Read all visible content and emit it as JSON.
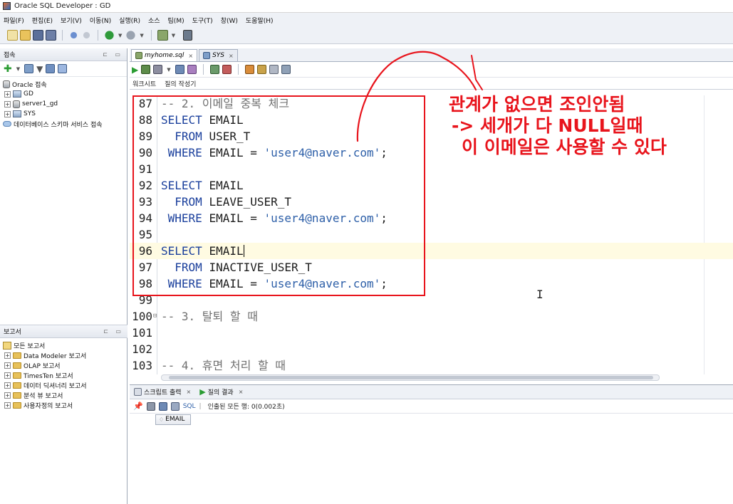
{
  "window": {
    "title": "Oracle SQL Developer : GD"
  },
  "menu": [
    "파일(F)",
    "편집(E)",
    "보기(V)",
    "이동(N)",
    "실행(R)",
    "소스",
    "팀(M)",
    "도구(T)",
    "창(W)",
    "도움말(H)"
  ],
  "connections_panel": {
    "title": "접속",
    "tree": [
      {
        "label": "Oracle 접속",
        "icon": "database-icon"
      },
      {
        "label": "GD",
        "icon": "connection-icon"
      },
      {
        "label": "server1_gd",
        "icon": "database-icon"
      },
      {
        "label": "SYS",
        "icon": "connection-icon"
      },
      {
        "label": "데이터베이스 스키마 서비스 접속",
        "icon": "cloud-icon"
      }
    ]
  },
  "reports_panel": {
    "title": "보고서",
    "tree": [
      {
        "label": "모든 보고서"
      },
      {
        "label": "Data Modeler 보고서"
      },
      {
        "label": "OLAP 보고서"
      },
      {
        "label": "TimesTen 보고서"
      },
      {
        "label": "데이터 딕셔너리 보고서"
      },
      {
        "label": "분석 뷰 보고서"
      },
      {
        "label": "사용자정의 보고서"
      }
    ]
  },
  "editor": {
    "tabs": [
      {
        "label": "myhome.sql",
        "active": true
      },
      {
        "label": "SYS",
        "active": false
      }
    ],
    "sub_tabs": [
      "워크시트",
      "질의 작성기"
    ],
    "lines": [
      {
        "n": "87",
        "tokens": [
          {
            "t": "-- 2. 이메일 중복 체크",
            "c": "com"
          }
        ]
      },
      {
        "n": "88",
        "tokens": [
          {
            "t": "SELECT ",
            "c": "kw"
          },
          {
            "t": "EMAIL",
            "c": "id"
          }
        ]
      },
      {
        "n": "89",
        "tokens": [
          {
            "t": "  FROM ",
            "c": "kw"
          },
          {
            "t": "USER_T",
            "c": "id"
          }
        ]
      },
      {
        "n": "90",
        "tokens": [
          {
            "t": " WHERE ",
            "c": "kw"
          },
          {
            "t": "EMAIL = ",
            "c": "id"
          },
          {
            "t": "'user4@naver.com'",
            "c": "str"
          },
          {
            "t": ";",
            "c": "id"
          }
        ]
      },
      {
        "n": "91",
        "tokens": []
      },
      {
        "n": "92",
        "tokens": [
          {
            "t": "SELECT ",
            "c": "kw"
          },
          {
            "t": "EMAIL",
            "c": "id"
          }
        ]
      },
      {
        "n": "93",
        "tokens": [
          {
            "t": "  FROM ",
            "c": "kw"
          },
          {
            "t": "LEAVE_USER_T",
            "c": "id"
          }
        ]
      },
      {
        "n": "94",
        "tokens": [
          {
            "t": " WHERE ",
            "c": "kw"
          },
          {
            "t": "EMAIL = ",
            "c": "id"
          },
          {
            "t": "'user4@naver.com'",
            "c": "str"
          },
          {
            "t": ";",
            "c": "id"
          }
        ]
      },
      {
        "n": "95",
        "tokens": []
      },
      {
        "n": "96",
        "tokens": [
          {
            "t": "SELECT ",
            "c": "kw"
          },
          {
            "t": "EMAIL",
            "c": "id"
          }
        ],
        "current": true
      },
      {
        "n": "97",
        "tokens": [
          {
            "t": "  FROM ",
            "c": "kw"
          },
          {
            "t": "INACTIVE_USER_T",
            "c": "id"
          }
        ]
      },
      {
        "n": "98",
        "tokens": [
          {
            "t": " WHERE ",
            "c": "kw"
          },
          {
            "t": "EMAIL = ",
            "c": "id"
          },
          {
            "t": "'user4@naver.com'",
            "c": "str"
          },
          {
            "t": ";",
            "c": "id"
          }
        ]
      },
      {
        "n": "99",
        "tokens": []
      },
      {
        "n": "100",
        "fold": true,
        "tokens": [
          {
            "t": "-- 3. 탈퇴 할 때",
            "c": "com"
          }
        ]
      },
      {
        "n": "101",
        "tokens": []
      },
      {
        "n": "102",
        "tokens": []
      },
      {
        "n": "103",
        "tokens": [
          {
            "t": "-- 4. 휴면 처리 할 때",
            "c": "com"
          }
        ]
      }
    ]
  },
  "annotation": {
    "lines": [
      "관계가 없으면 조인안됨",
      "-> 세개가 다 NULL일때",
      "이 이메일은 사용할 수 있다"
    ],
    "color": "#e8141c"
  },
  "output": {
    "tabs": [
      "스크립트 출력",
      "질의 결과"
    ],
    "sql_label": "SQL",
    "fetched_text": "인출된 모든 행: 0(0.002초)",
    "columns": [
      "EMAIL"
    ]
  },
  "colors": {
    "keyword": "#1a3f9c",
    "string": "#2d5fa8",
    "comment": "#707070"
  }
}
